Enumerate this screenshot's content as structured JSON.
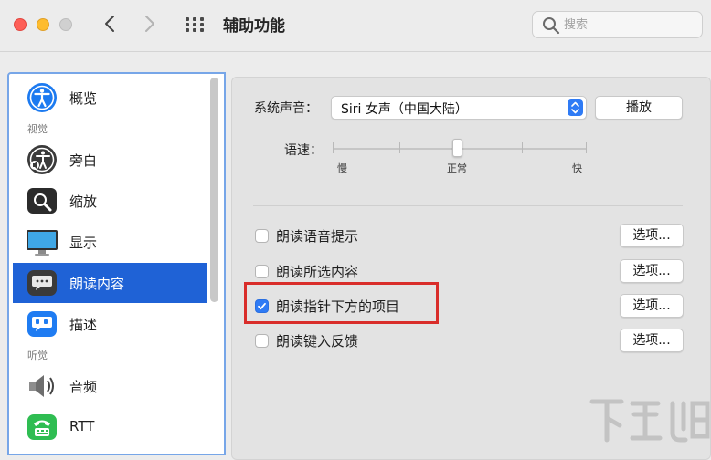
{
  "window": {
    "title": "辅助功能",
    "search_placeholder": "搜索"
  },
  "sidebar": {
    "items": [
      {
        "label": "概览",
        "icon": "accessibility-icon"
      },
      {
        "label": "旁白",
        "icon": "voiceover-icon"
      },
      {
        "label": "缩放",
        "icon": "zoom-icon"
      },
      {
        "label": "显示",
        "icon": "display-icon"
      },
      {
        "label": "朗读内容",
        "icon": "spoken-content-icon",
        "selected": true
      },
      {
        "label": "描述",
        "icon": "descriptions-icon"
      },
      {
        "label": "音频",
        "icon": "speaker-icon"
      },
      {
        "label": "RTT",
        "icon": "rtt-phone-icon"
      }
    ],
    "sections": {
      "vision": "视觉",
      "hearing": "听觉"
    }
  },
  "content": {
    "system_voice_label": "系统声音：",
    "system_voice_value": "Siri 女声（中国大陆）",
    "play_label": "播放",
    "speaking_rate_label": "语速：",
    "rate_slow": "慢",
    "rate_normal": "正常",
    "rate_fast": "快",
    "speaking_rate_value": 0.5,
    "options": [
      {
        "label": "朗读语音提示",
        "checked": false,
        "button": "选项..."
      },
      {
        "label": "朗读所选内容",
        "checked": false,
        "button": "选项..."
      },
      {
        "label": "朗读指针下方的项目",
        "checked": true,
        "button": "选项..."
      },
      {
        "label": "朗读键入反馈",
        "checked": false,
        "button": "选项..."
      }
    ]
  },
  "colors": {
    "accent": "#1f62d6",
    "highlight_box": "#d92d2a"
  }
}
